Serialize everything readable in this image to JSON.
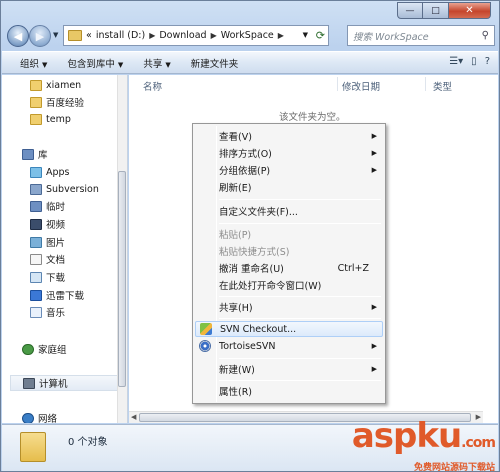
{
  "window": {
    "caption_buttons": {
      "minimize": "—",
      "maximize": "□",
      "close": "✕"
    }
  },
  "nav": {
    "back_icon": "arrow-left-icon",
    "forward_icon": "arrow-right-icon",
    "breadcrumb": [
      "install (D:)",
      "Download",
      "WorkSpace"
    ],
    "breadcrumb_lead": "«",
    "search_placeholder": "搜索 WorkSpace"
  },
  "toolbar": {
    "items": [
      "组织",
      "包含到库中",
      "共享",
      "新建文件夹"
    ]
  },
  "sidebar": {
    "items": [
      {
        "label": "xiamen",
        "icon": "folder-icon"
      },
      {
        "label": "百度经验",
        "icon": "folder-icon"
      },
      {
        "label": "temp",
        "icon": "folder-icon"
      },
      {
        "label": "库",
        "icon": "library-icon"
      },
      {
        "label": "Apps",
        "icon": "apps-icon"
      },
      {
        "label": "Subversion",
        "icon": "subversion-icon"
      },
      {
        "label": "临时",
        "icon": "library-icon"
      },
      {
        "label": "视频",
        "icon": "video-icon"
      },
      {
        "label": "图片",
        "icon": "picture-icon"
      },
      {
        "label": "文档",
        "icon": "document-icon"
      },
      {
        "label": "下载",
        "icon": "download-icon"
      },
      {
        "label": "迅雷下载",
        "icon": "thunder-icon"
      },
      {
        "label": "音乐",
        "icon": "music-icon"
      },
      {
        "label": "家庭组",
        "icon": "homegroup-icon"
      },
      {
        "label": "计算机",
        "icon": "computer-icon"
      },
      {
        "label": "网络",
        "icon": "network-icon"
      }
    ]
  },
  "main": {
    "columns": [
      "名称",
      "修改日期",
      "类型"
    ],
    "empty_message": "该文件夹为空。"
  },
  "context_menu": {
    "items": [
      {
        "label": "查看(V)",
        "submenu": true
      },
      {
        "label": "排序方式(O)",
        "submenu": true
      },
      {
        "label": "分组依据(P)",
        "submenu": true
      },
      {
        "label": "刷新(E)"
      },
      {
        "label": "自定义文件夹(F)..."
      },
      {
        "label": "粘贴(P)",
        "disabled": true
      },
      {
        "label": "粘贴快捷方式(S)",
        "disabled": true
      },
      {
        "label": "撤消 重命名(U)",
        "shortcut": "Ctrl+Z"
      },
      {
        "label": "在此处打开命令窗口(W)"
      },
      {
        "label": "共享(H)",
        "submenu": true
      },
      {
        "label": "SVN Checkout...",
        "icon": "svn-checkout-icon",
        "highlighted": true
      },
      {
        "label": "TortoiseSVN",
        "icon": "tortoisesvn-icon",
        "submenu": true
      },
      {
        "label": "新建(W)",
        "submenu": true
      },
      {
        "label": "属性(R)"
      }
    ]
  },
  "status": {
    "text": "0 个对象"
  },
  "watermark": {
    "logo_part1": "asp",
    "logo_part2": "ku",
    "logo_part3": ".com",
    "subtitle": "免费网站源码下载站"
  },
  "colors": {
    "window_frame": "#bcd2ee",
    "menu_highlight": "#dceafb",
    "watermark": "#e05a2a"
  }
}
